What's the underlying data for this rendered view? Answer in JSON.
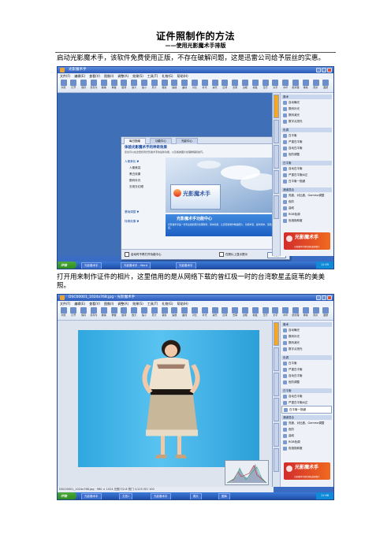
{
  "document": {
    "title": "证件照制作的方法",
    "subtitle": "——使用光影魔术手排版",
    "paragraph1": "启动光影魔术手，该软件免费使用正版，不存在破解问题，这是迅雷公司给予层丝的实惠。",
    "paragraph2": "打开用来制作证件的相片，这里借用的是从网络下载的曾红极一时的台湾歌星孟庭苇的美美照。"
  },
  "screenshot1": {
    "window_title": "光影魔术手",
    "menu": [
      "文件(F)",
      "编辑(E)",
      "查看(V)",
      "图像(I)",
      "调整(A)",
      "效果(S)",
      "工具(T)",
      "礼物(G)",
      "帮助(H)"
    ],
    "toolbar": [
      "浏览",
      "打开",
      "保存",
      "另存为",
      "撤销",
      "重做",
      "旋转",
      "放大",
      "缩小",
      "原大",
      "裁剪",
      "缩放",
      "曲线",
      "对比",
      "补光",
      "减光",
      "反转",
      "去雾",
      "边框",
      "模板",
      "日历",
      "文字",
      "水印",
      "批处理",
      "排版",
      "照片",
      "图册"
    ],
    "dialog": {
      "tabs": [
        "每日指南",
        "功能中心",
        "光影中心"
      ],
      "heading": "体验光影魔术手的神奇效果",
      "subtext": "您也可以在这里找到光影魔术手的最新功能，以及各类图片处理教程和技巧。",
      "sidebar_sections": [
        {
          "header": "人像美化 ▼",
          "items": [
            "人像美容",
            "黑白效果",
            "数码补光",
            "去斑去红眼"
          ]
        },
        {
          "header": "基础调整 ▼",
          "items": []
        },
        {
          "header": "特殊效果 ▼",
          "items": []
        }
      ],
      "product_name": "光影魔术手",
      "banner_title": "光影魔术手功能中心",
      "banner_text": "光影魔术手是一款专业级的照片处理软件，简单易用，让您轻松制作精美照片，功能丰富、操作简单，深受广大用户喜爱。",
      "checkbox_left": "启动时不再打开功能中心",
      "checkbox_right": "在照片上显示提示",
      "close_button": "关闭"
    },
    "panel_groups": [
      {
        "header": "魔术",
        "items": [
          "自动曝光",
          "数码补光",
          "数码减光",
          "数字点测光"
        ]
      },
      {
        "header": "色调",
        "items": [
          "白平衡",
          "严重白平衡",
          "自动白平衡",
          "色阶调整"
        ]
      },
      {
        "header": "白平衡",
        "items": [
          "自动白平衡",
          "严重白平衡纠正",
          "白平衡一指键"
        ]
      },
      {
        "header": "通道混合",
        "items": [
          "亮度、对比度、Gamma调整",
          "色阶",
          "曲线",
          "RGB色调",
          "色相饱和度"
        ]
      }
    ],
    "logo_text": "光影魔术手",
    "logo_caption": "光影魔术手帮您轻松处理照片",
    "taskbar_start": "开始",
    "taskbar_items": [
      "光影魔术手",
      "光影魔术手 - Word",
      "光影魔术手"
    ],
    "clock": "11:05"
  },
  "screenshot2": {
    "window_title": "DSC00001_1024x768.jpg - 光影魔术手",
    "status": "DSC00001_1024x768.jpg  ·  960 × 1024   光圈 F/2.8  快门 1/125  ISO 100",
    "taskbar_items": [
      "光影魔术手",
      "文档1",
      "光影魔术手",
      "照片",
      "图库"
    ],
    "clock": "11:08"
  }
}
